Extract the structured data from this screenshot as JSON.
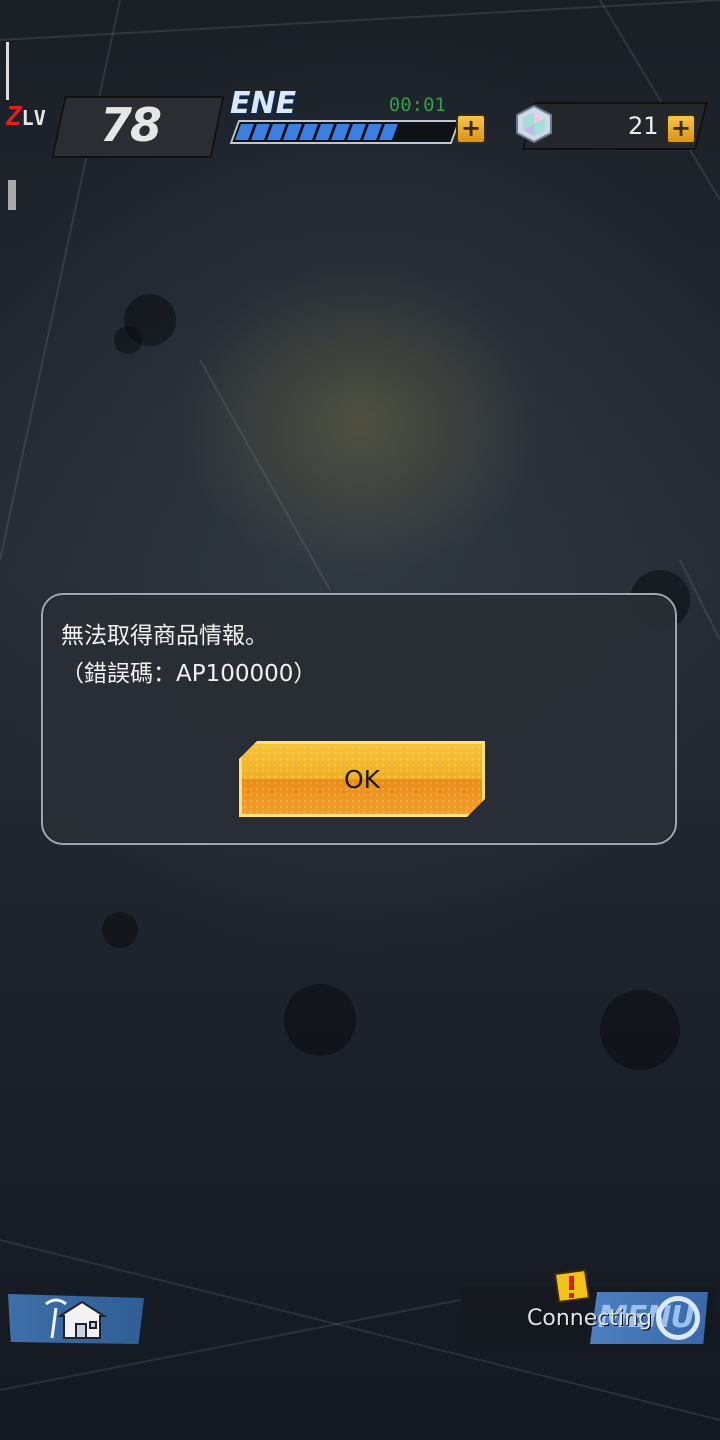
{
  "hud": {
    "level_badge_z": "Z",
    "level_badge_lv": "LV",
    "level_value": "78",
    "energy_label": "ENE",
    "energy_timer": "00:01",
    "energy_fill_fraction": 0.72,
    "gem_count": "21",
    "plus_symbol": "+"
  },
  "dialog": {
    "message": "無法取得商品情報。\n（錯誤碼：AP100000）",
    "ok_label": "OK"
  },
  "bottom": {
    "connecting_text": "Connecting",
    "menu_text": "MENU",
    "icons": [
      "home-icon",
      "alert-icon",
      "refresh-icon",
      "gem-icon"
    ]
  },
  "colors": {
    "accent_gold": "#f1ae22",
    "energy_blue": "#3c7fe0",
    "timer_green": "#2f9f45",
    "level_red": "#e02020"
  }
}
